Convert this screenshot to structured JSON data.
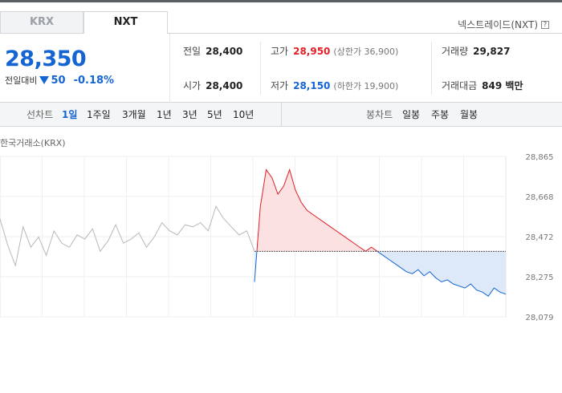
{
  "tabs": [
    {
      "label": "KRX",
      "active": false
    },
    {
      "label": "NXT",
      "active": true
    }
  ],
  "nxt_link": "넥스트레이드(NXT)",
  "price": {
    "current": "28,350",
    "change_label": "전일대비",
    "change_abs": "50",
    "change_rate": "-0.18%",
    "direction": "down"
  },
  "stats": {
    "prev_close": {
      "label": "전일",
      "value": "28,400"
    },
    "open": {
      "label": "시가",
      "value": "28,400"
    },
    "high": {
      "label": "고가",
      "value": "28,950",
      "sub": "(상한가 36,900)"
    },
    "low": {
      "label": "저가",
      "value": "28,150",
      "sub": "(하한가 19,900)"
    },
    "volume": {
      "label": "거래량",
      "value": "29,827"
    },
    "amount": {
      "label": "거래대금",
      "value": "849 백만"
    }
  },
  "period_bar": {
    "line_label": "선차트",
    "line_options": [
      "1일",
      "1주일",
      "3개월",
      "1년",
      "3년",
      "5년",
      "10년"
    ],
    "line_active": "1일",
    "candle_label": "봉차트",
    "candle_options": [
      "일봉",
      "주봉",
      "월봉"
    ]
  },
  "chart_source": "한국거래소(KRX)",
  "colors": {
    "up": "#e21f26",
    "down": "#1465d3",
    "pre": "#b8b8b8",
    "up_fill": "#fbe1e1",
    "down_fill": "#dde9f8"
  },
  "chart_data": {
    "type": "line",
    "title": "",
    "xlabel": "",
    "ylabel": "",
    "y_ticks": [
      "28,865",
      "28,668",
      "28,472",
      "28,275",
      "28,079"
    ],
    "ylim": [
      28079,
      28865
    ],
    "baseline": 28400,
    "series": [
      {
        "segment": "pre-market",
        "values": [
          28560,
          28430,
          28330,
          28520,
          28420,
          28470,
          28380,
          28500,
          28440,
          28420,
          28480,
          28460,
          28510,
          28400,
          28450,
          28530,
          28440,
          28460,
          28490,
          28420,
          28470,
          28540,
          28500,
          28480,
          28530,
          28520,
          28540,
          28500,
          28620,
          28560,
          28520,
          28480,
          28500,
          28400
        ]
      },
      {
        "segment": "regular",
        "values": [
          28250,
          28620,
          28800,
          28760,
          28680,
          28720,
          28800,
          28700,
          28640,
          28600,
          28580,
          28560,
          28540,
          28520,
          28500,
          28480,
          28460,
          28440,
          28420,
          28400,
          28420,
          28400,
          28380,
          28360,
          28340,
          28320,
          28300,
          28290,
          28310,
          28280,
          28300,
          28270,
          28250,
          28260,
          28240,
          28230,
          28220,
          28240,
          28210,
          28200,
          28180,
          28220,
          28200,
          28190
        ]
      }
    ]
  }
}
